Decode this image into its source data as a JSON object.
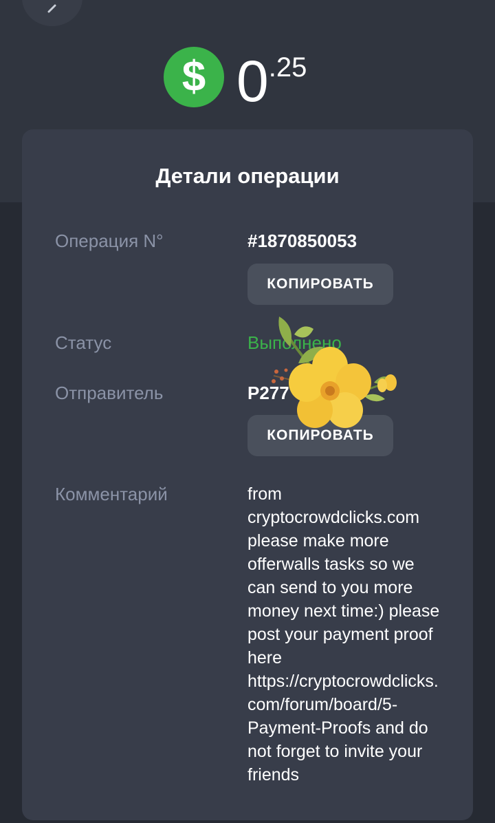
{
  "header": {
    "currency_symbol": "$",
    "amount_main": "0",
    "amount_fraction": ".25"
  },
  "card": {
    "title": "Детали операции",
    "operation": {
      "label": "Операция N°",
      "value": "#1870850053",
      "copy_label": "КОПИРОВАТЬ"
    },
    "status": {
      "label": "Статус",
      "value": "Выполнено"
    },
    "sender": {
      "label": "Отправитель",
      "value": "P277",
      "copy_label": "КОПИРОВАТЬ"
    },
    "comment": {
      "label": "Комментарий",
      "value": "from cryptocrowdclicks.com please make more offerwalls tasks so we can send to you more money next time:) please post your payment proof here https://cryptocrowdclicks.com/forum/board/5-Payment-Proofs and do not forget to invite your friends"
    }
  },
  "icons": {
    "back": "chevron-left-icon",
    "currency": "dollar-icon",
    "sticker": "flower-sticker-icon"
  },
  "colors": {
    "accent_green": "#3bb34a",
    "background": "#262a33",
    "header_band": "#30353f",
    "card": "#383d4a",
    "button": "#4a505c",
    "label": "#8b93a7"
  }
}
